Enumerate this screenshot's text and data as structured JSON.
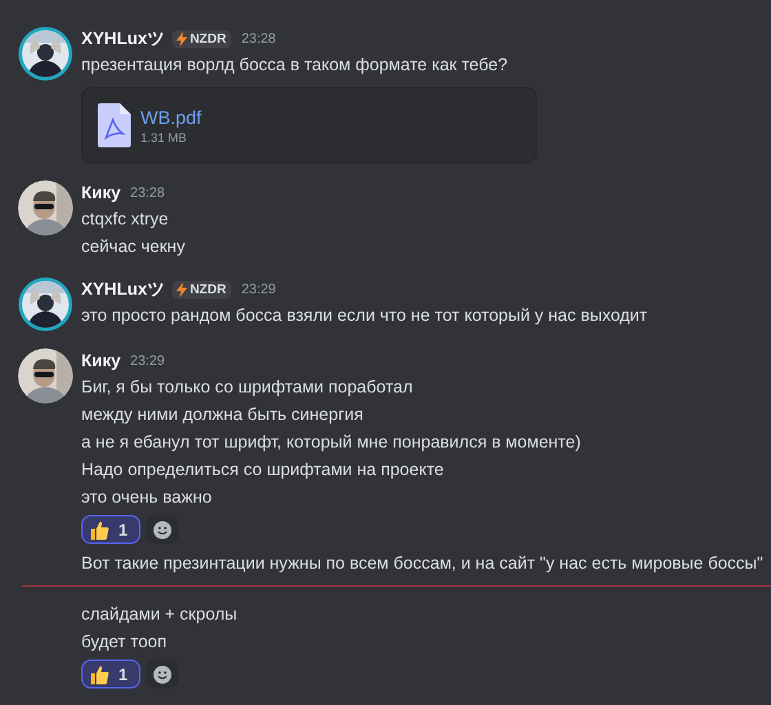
{
  "messages": [
    {
      "kind": "group",
      "author": {
        "name": "XYHLuxツ",
        "kind": "ringed",
        "tag": "NZDR"
      },
      "time": "23:28",
      "lines": [
        "презентация ворлд босса в таком формате как тебе?"
      ],
      "attachment": {
        "name": "WB.pdf",
        "size": "1.31 MB"
      }
    },
    {
      "kind": "group",
      "author": {
        "name": "Кику",
        "kind": "plain"
      },
      "time": "23:28",
      "lines": [
        "ctqxfc xtrye",
        "сейчас чекну"
      ]
    },
    {
      "kind": "group",
      "author": {
        "name": "XYHLuxツ",
        "kind": "ringed",
        "tag": "NZDR"
      },
      "time": "23:29",
      "lines": [
        "это просто рандом босса взяли если что не тот который у нас выходит"
      ]
    },
    {
      "kind": "group",
      "author": {
        "name": "Кику",
        "kind": "plain"
      },
      "time": "23:29",
      "lines": [
        "Биг, я бы только со шрифтами поработал",
        "между ними должна быть синергия",
        "а не я ебанул тот шрифт, который мне понравился в моменте)",
        "Надо определиться со шрифтами на проекте",
        "это очень важно"
      ],
      "reactions": [
        {
          "count": "1",
          "selected": true
        }
      ]
    },
    {
      "kind": "continuation",
      "lines": [
        "Вот такие презинтации нужны по всем боссам, и на сайт \"у нас есть мировые боссы\""
      ]
    },
    {
      "kind": "new_divider"
    },
    {
      "kind": "continuation",
      "lines": [
        "слайдами + скролы",
        "будет тооп"
      ],
      "reactions": [
        {
          "count": "1",
          "selected": true
        }
      ]
    }
  ]
}
